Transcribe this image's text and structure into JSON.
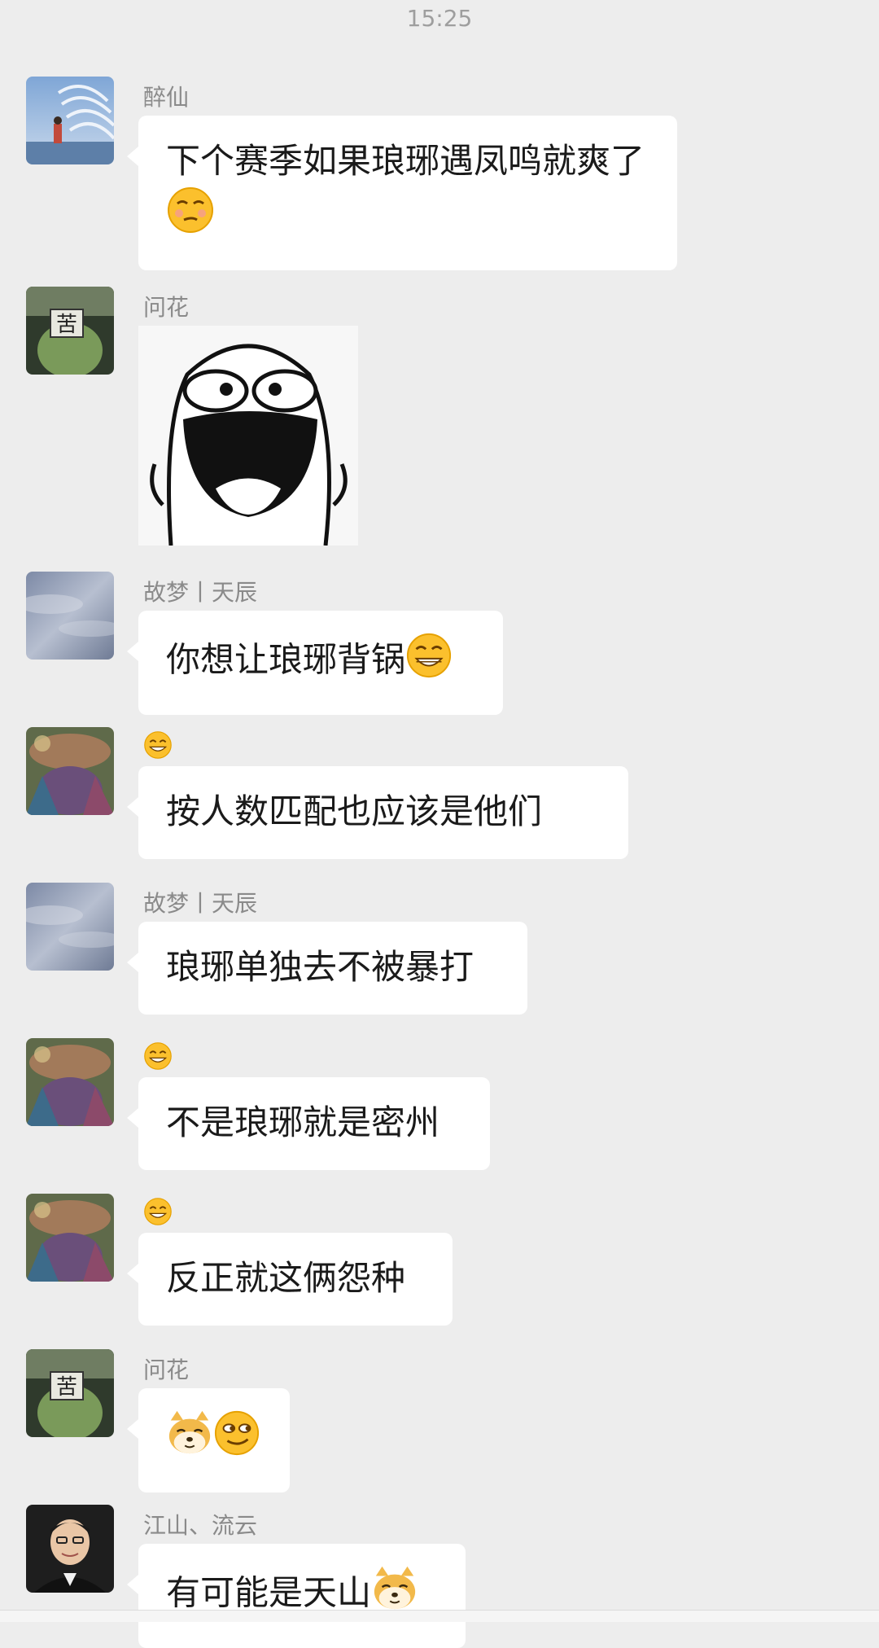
{
  "timestamp": "15:25",
  "messages": [
    {
      "sender": "醉仙",
      "text": "下个赛季如果琅琊遇凤鸣就爽了",
      "emoji": "smirk-emoji"
    },
    {
      "sender": "问花",
      "sticker": "laughing-face-sticker"
    },
    {
      "sender": "故梦丨天辰",
      "text": "你想让琅琊背锅",
      "emoji": "grin-emoji"
    },
    {
      "sender_emoji": "grinning-emoji",
      "text": "按人数匹配也应该是他们"
    },
    {
      "sender": "故梦丨天辰",
      "text": "琅琊单独去不被暴打"
    },
    {
      "sender_emoji": "grinning-emoji",
      "text": "不是琅琊就是密州"
    },
    {
      "sender_emoji": "grinning-emoji",
      "text": "反正就这俩怨种"
    },
    {
      "sender": "问花",
      "emojis": [
        "doge-emoji",
        "sly-smile-emoji"
      ]
    },
    {
      "sender": "江山、流云",
      "text": "有可能是天山",
      "emoji": "doge-emoji"
    }
  ],
  "colors": {
    "background": "#ededed",
    "bubble": "#ffffff",
    "sender_text": "#8a8a8a",
    "message_text": "#1a1a1a"
  }
}
